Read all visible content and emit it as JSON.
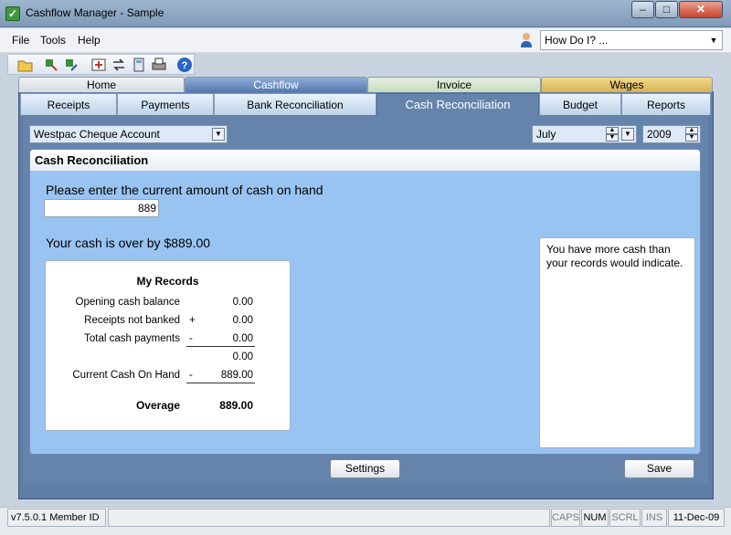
{
  "window": {
    "title": "Cashflow Manager - Sample",
    "minimize": "–",
    "maximize": "□",
    "close": "✕",
    "icon": "ledger-icon"
  },
  "menu": {
    "file": "File",
    "tools": "Tools",
    "help": "Help"
  },
  "howdoi": {
    "value": "How Do I? ...",
    "arrow": "▼"
  },
  "toolbar": {
    "icons": [
      "open-folder-icon",
      "export-icon",
      "import-icon",
      "backup-icon",
      "transfer-icon",
      "calculator-icon",
      "print-icon",
      "help-circle-icon"
    ]
  },
  "top_tabs": [
    "Home",
    "Cashflow",
    "Invoice",
    "Wages"
  ],
  "sub_tabs": [
    "Receipts",
    "Payments",
    "Bank Reconciliation",
    "Cash Reconciliation",
    "Budget",
    "Reports"
  ],
  "filters": {
    "account": "Westpac Cheque Account",
    "month": "July",
    "year": "2009",
    "arrow": "▼",
    "spin_up": "▲",
    "spin_down": "▼"
  },
  "panel": {
    "title": "Cash Reconciliation",
    "prompt": "Please enter the current amount of cash on hand",
    "cash_value": "889",
    "result": "Your cash is over by $889.00",
    "message": "You have more cash than your records would indicate."
  },
  "records": {
    "heading": "My Records",
    "rows": [
      {
        "label": "Opening cash balance",
        "op": "",
        "value": "0.00"
      },
      {
        "label": "Receipts not banked",
        "op": "+",
        "value": "0.00"
      },
      {
        "label": "Total cash payments",
        "op": "-",
        "value": "0.00"
      },
      {
        "label": "",
        "op": "",
        "value": "0.00"
      },
      {
        "label": "Current Cash On Hand",
        "op": "-",
        "value": "889.00"
      }
    ],
    "total_label": "Overage",
    "total_value": "889.00"
  },
  "buttons": {
    "settings": "Settings",
    "save": "Save"
  },
  "status": {
    "version": "v7.5.0.1 Member ID",
    "caps": "CAPS",
    "num": "NUM",
    "scrl": "SCRL",
    "ins": "INS",
    "date": "11-Dec-09"
  },
  "colors": {
    "active_tab": "#5479b0",
    "panel_bg": "#99c4f2",
    "frame": "#5f7ea6",
    "invoice_tab": "#cfe3c7",
    "wages_tab": "#e3c36a"
  }
}
